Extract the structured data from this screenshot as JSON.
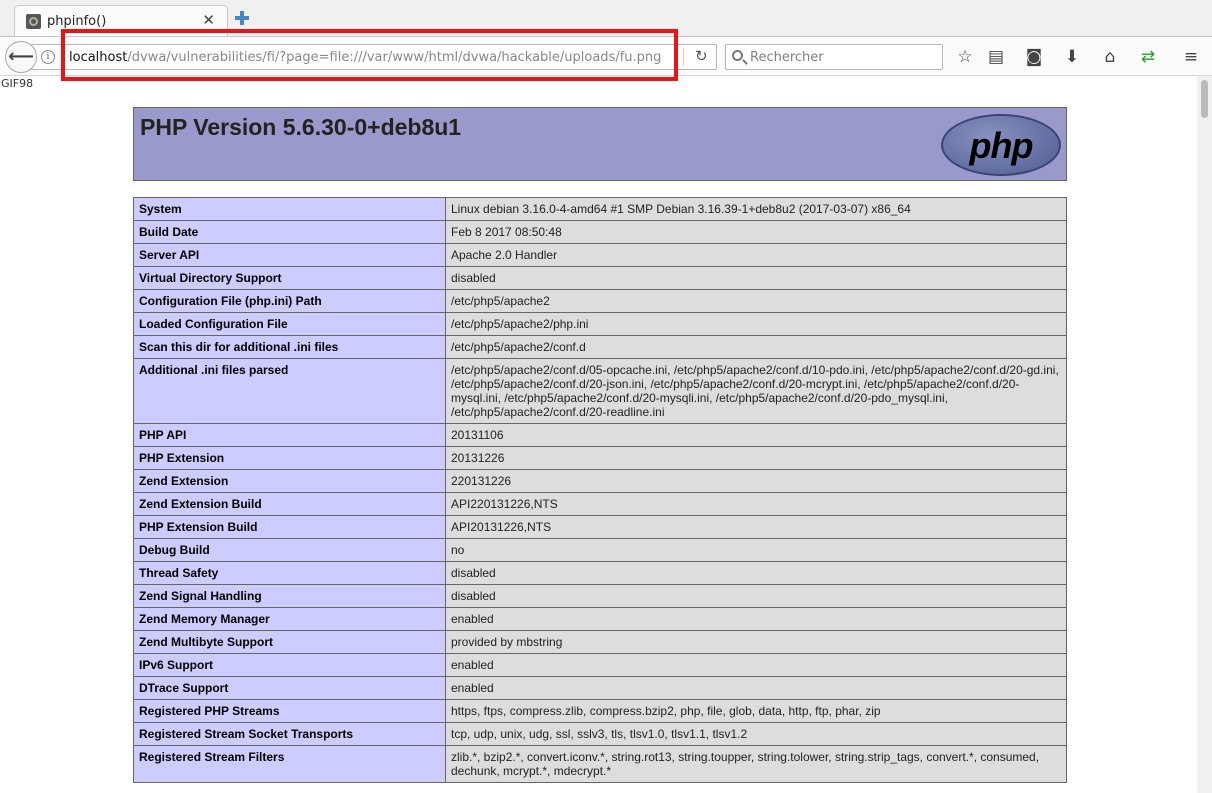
{
  "browser": {
    "tab": {
      "title": "phpinfo()",
      "favicon": "page-favicon",
      "close_label": "✕"
    },
    "new_tab_icon": "plus-icon",
    "url": {
      "host": "localhost",
      "path": "/dvwa/vulnerabilities/fi/?page=file:///var/www/html/dvwa/hackable/uploads/fu.png"
    },
    "search": {
      "placeholder": "Rechercher"
    },
    "toolbar_icons": [
      "star-icon",
      "reading-list-icon",
      "pocket-icon",
      "download-icon",
      "home-icon",
      "sync-icon",
      "menu-icon"
    ],
    "highlight_color": "#e8141a"
  },
  "page": {
    "prefix_text": "GIF98",
    "header": {
      "title": "PHP Version 5.6.30-0+deb8u1",
      "logo_text": "php"
    },
    "rows": [
      {
        "key": "System",
        "value": "Linux debian 3.16.0-4-amd64 #1 SMP Debian 3.16.39-1+deb8u2 (2017-03-07) x86_64"
      },
      {
        "key": "Build Date",
        "value": "Feb 8 2017 08:50:48"
      },
      {
        "key": "Server API",
        "value": "Apache 2.0 Handler"
      },
      {
        "key": "Virtual Directory Support",
        "value": "disabled"
      },
      {
        "key": "Configuration File (php.ini) Path",
        "value": "/etc/php5/apache2"
      },
      {
        "key": "Loaded Configuration File",
        "value": "/etc/php5/apache2/php.ini"
      },
      {
        "key": "Scan this dir for additional .ini files",
        "value": "/etc/php5/apache2/conf.d"
      },
      {
        "key": "Additional .ini files parsed",
        "value": "/etc/php5/apache2/conf.d/05-opcache.ini, /etc/php5/apache2/conf.d/10-pdo.ini, /etc/php5/apache2/conf.d/20-gd.ini, /etc/php5/apache2/conf.d/20-json.ini, /etc/php5/apache2/conf.d/20-mcrypt.ini, /etc/php5/apache2/conf.d/20-mysql.ini, /etc/php5/apache2/conf.d/20-mysqli.ini, /etc/php5/apache2/conf.d/20-pdo_mysql.ini, /etc/php5/apache2/conf.d/20-readline.ini"
      },
      {
        "key": "PHP API",
        "value": "20131106"
      },
      {
        "key": "PHP Extension",
        "value": "20131226"
      },
      {
        "key": "Zend Extension",
        "value": "220131226"
      },
      {
        "key": "Zend Extension Build",
        "value": "API220131226,NTS"
      },
      {
        "key": "PHP Extension Build",
        "value": "API20131226,NTS"
      },
      {
        "key": "Debug Build",
        "value": "no"
      },
      {
        "key": "Thread Safety",
        "value": "disabled"
      },
      {
        "key": "Zend Signal Handling",
        "value": "disabled"
      },
      {
        "key": "Zend Memory Manager",
        "value": "enabled"
      },
      {
        "key": "Zend Multibyte Support",
        "value": "provided by mbstring"
      },
      {
        "key": "IPv6 Support",
        "value": "enabled"
      },
      {
        "key": "DTrace Support",
        "value": "enabled"
      },
      {
        "key": "Registered PHP Streams",
        "value": "https, ftps, compress.zlib, compress.bzip2, php, file, glob, data, http, ftp, phar, zip"
      },
      {
        "key": "Registered Stream Socket Transports",
        "value": "tcp, udp, unix, udg, ssl, sslv3, tls, tlsv1.0, tlsv1.1, tlsv1.2"
      },
      {
        "key": "Registered Stream Filters",
        "value": "zlib.*, bzip2.*, convert.iconv.*, string.rot13, string.toupper, string.tolower, string.strip_tags, convert.*, consumed, dechunk, mcrypt.*, mdecrypt.*"
      }
    ]
  }
}
